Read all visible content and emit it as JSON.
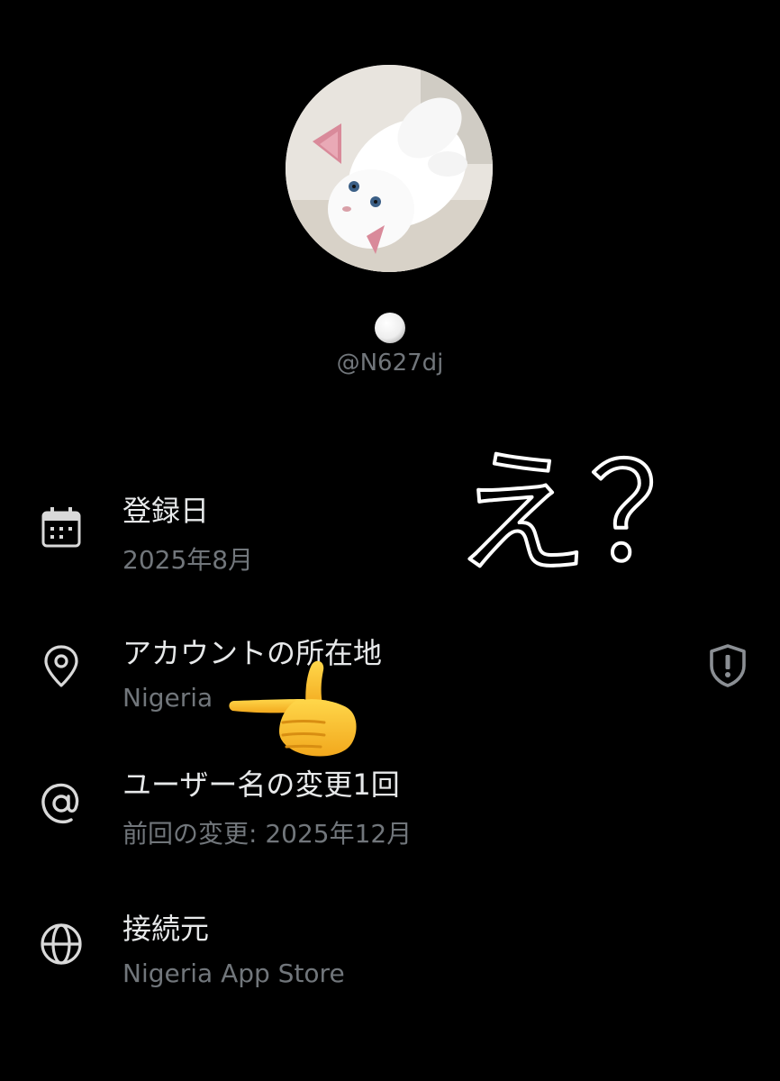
{
  "profile": {
    "handle": "@N627dj",
    "avatar_icon": "cat-avatar-icon",
    "name_icon": "white-circle-icon"
  },
  "about": {
    "rows": [
      {
        "icon": "calendar-icon",
        "title": "登録日",
        "subtitle": "2025年8月"
      },
      {
        "icon": "location-pin-icon",
        "title": "アカウントの所在地",
        "subtitle": "Nigeria"
      },
      {
        "icon": "at-sign-icon",
        "title": "ユーザー名の変更1回",
        "subtitle": "前回の変更: 2025年12月"
      },
      {
        "icon": "globe-icon",
        "title": "接続元",
        "subtitle": "Nigeria App Store"
      }
    ],
    "location_badge_icon": "shield-alert-icon"
  },
  "overlay": {
    "annotation": "え？",
    "pointing_hand_icon": "pointing-hand-emoji"
  },
  "colors": {
    "background": "#000000",
    "primary_text": "#e7e9ea",
    "secondary_text": "#71767b",
    "icon": "#d9d9d9"
  }
}
